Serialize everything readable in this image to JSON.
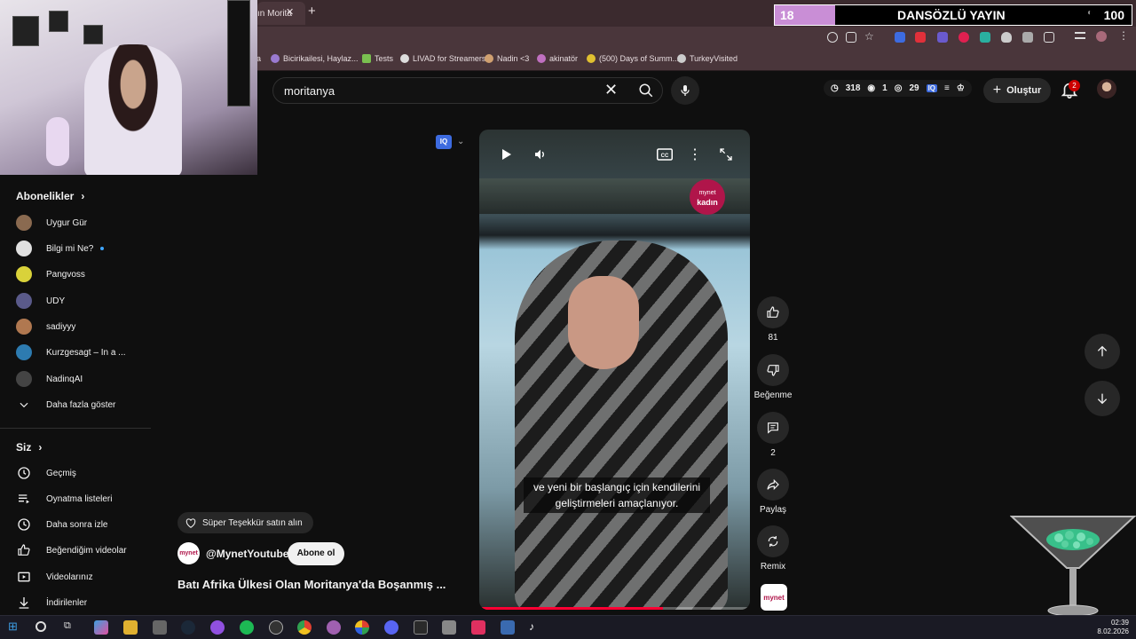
{
  "browser": {
    "tab_title": "ın Morita",
    "bookmarks": [
      "a",
      "Bicirikailesi, Haylaz...",
      "Tests",
      "LIVAD for Streamers",
      "Nadin <3",
      "akinatör",
      "(500) Days of Summ...",
      "TurkeyVisited"
    ]
  },
  "overlay": {
    "left_num": "18",
    "title": "DANSÖZLÜ YAYIN",
    "right_num": "100"
  },
  "search": {
    "query": "moritanya"
  },
  "stats": {
    "views": "318",
    "viewers": "1",
    "watching": "29"
  },
  "header": {
    "create_label": "Oluştur",
    "notif_count": "2"
  },
  "sidebar": {
    "subs_heading": "Abonelikler",
    "subs": [
      {
        "label": "Uygur Gür",
        "color": "#8a6a50"
      },
      {
        "label": "Bilgi mi Ne?",
        "color": "#e0e0e0"
      },
      {
        "label": "Pangvoss",
        "color": "#d9d23a"
      },
      {
        "label": "UDY",
        "color": "#5a5a8a"
      },
      {
        "label": "sadiyyy",
        "color": "#b07850"
      },
      {
        "label": "Kurzgesagt – In a ...",
        "color": "#2d7bb0"
      },
      {
        "label": "NadinqAI",
        "color": "#444444"
      }
    ],
    "show_more": "Daha fazla göster",
    "you_heading": "Siz",
    "you_items": [
      "Geçmiş",
      "Oynatma listeleri",
      "Daha sonra izle",
      "Beğendiğim videolar",
      "Videolarınız",
      "İndirilenler"
    ]
  },
  "player": {
    "brand_top": "mynet",
    "brand_bottom": "kadın",
    "caption_line1": "ve yeni bir başlangıç için kendilerini",
    "caption_line2": "geliştirmeleri amaçlanıyor.",
    "progress": 0.68
  },
  "actions": {
    "like_count": "81",
    "dislike_label": "Beğenme",
    "comment_count": "2",
    "share_label": "Paylaş",
    "remix_label": "Remix"
  },
  "video": {
    "thanks_label": "Süper Teşekkür satın alın",
    "channel_name": "@MynetYoutube",
    "subscribe_label": "Abone ol",
    "title": "Batı Afrika Ülkesi Olan Moritanya'da Boşanmış ..."
  },
  "taskbar": {
    "time": "02:39",
    "date": "8.02.2026"
  }
}
